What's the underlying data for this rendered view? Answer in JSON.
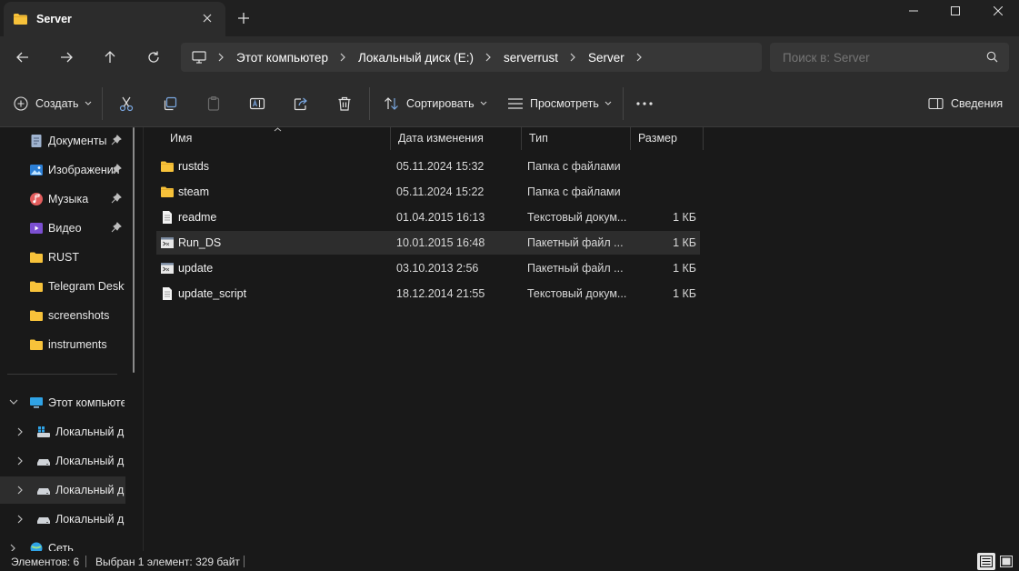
{
  "window": {
    "tab_title": "Server",
    "new_tab_icon": "plus-icon",
    "controls": [
      "minimize-icon",
      "maximize-icon",
      "close-icon"
    ]
  },
  "nav": {
    "breadcrumbs": [
      "Этот компьютер",
      "Локальный диск (E:)",
      "serverrust",
      "Server"
    ],
    "search_placeholder": "Поиск в: Server"
  },
  "toolbar": {
    "create_label": "Создать",
    "sort_label": "Сортировать",
    "view_label": "Просмотреть",
    "details_label": "Сведения"
  },
  "sidebar": {
    "quick": [
      {
        "label": "Документы",
        "icon": "documents-icon",
        "pinned": true
      },
      {
        "label": "Изображения",
        "icon": "pictures-icon",
        "pinned": true
      },
      {
        "label": "Музыка",
        "icon": "music-icon",
        "pinned": true
      },
      {
        "label": "Видео",
        "icon": "video-icon",
        "pinned": true
      },
      {
        "label": "RUST",
        "icon": "folder-icon",
        "pinned": false
      },
      {
        "label": "Telegram Desktop",
        "icon": "folder-icon",
        "pinned": false
      },
      {
        "label": "screenshots",
        "icon": "folder-icon",
        "pinned": false
      },
      {
        "label": "instruments",
        "icon": "folder-icon",
        "pinned": false
      }
    ],
    "this_pc": "Этот компьютер",
    "drives": [
      {
        "label": "Локальный диск",
        "icon": "system-drive-icon"
      },
      {
        "label": "Локальный диск",
        "icon": "drive-icon"
      },
      {
        "label": "Локальный диск",
        "icon": "drive-icon"
      },
      {
        "label": "Локальный диск",
        "icon": "drive-icon"
      }
    ],
    "network": "Сеть"
  },
  "columns": {
    "name": "Имя",
    "date": "Дата изменения",
    "type": "Тип",
    "size": "Размер"
  },
  "files": [
    {
      "name": "rustds",
      "date": "05.11.2024 15:32",
      "type": "Папка с файлами",
      "size": "",
      "icon": "folder-icon"
    },
    {
      "name": "steam",
      "date": "05.11.2024 15:22",
      "type": "Папка с файлами",
      "size": "",
      "icon": "folder-icon"
    },
    {
      "name": "readme",
      "date": "01.04.2015 16:13",
      "type": "Текстовый докум...",
      "size": "1 КБ",
      "icon": "text-file-icon"
    },
    {
      "name": "Run_DS",
      "date": "10.01.2015 16:48",
      "type": "Пакетный файл ...",
      "size": "1 КБ",
      "icon": "batch-file-icon"
    },
    {
      "name": "update",
      "date": "03.10.2013 2:56",
      "type": "Пакетный файл ...",
      "size": "1 КБ",
      "icon": "batch-file-icon"
    },
    {
      "name": "update_script",
      "date": "18.12.2014 21:55",
      "type": "Текстовый докум...",
      "size": "1 КБ",
      "icon": "text-file-icon"
    }
  ],
  "status": {
    "count": "Элементов: 6",
    "selection": "Выбран 1 элемент: 329 байт"
  },
  "colors": {
    "folder": "#F7C23A",
    "background": "#191919",
    "chrome": "#2C2C2C"
  }
}
